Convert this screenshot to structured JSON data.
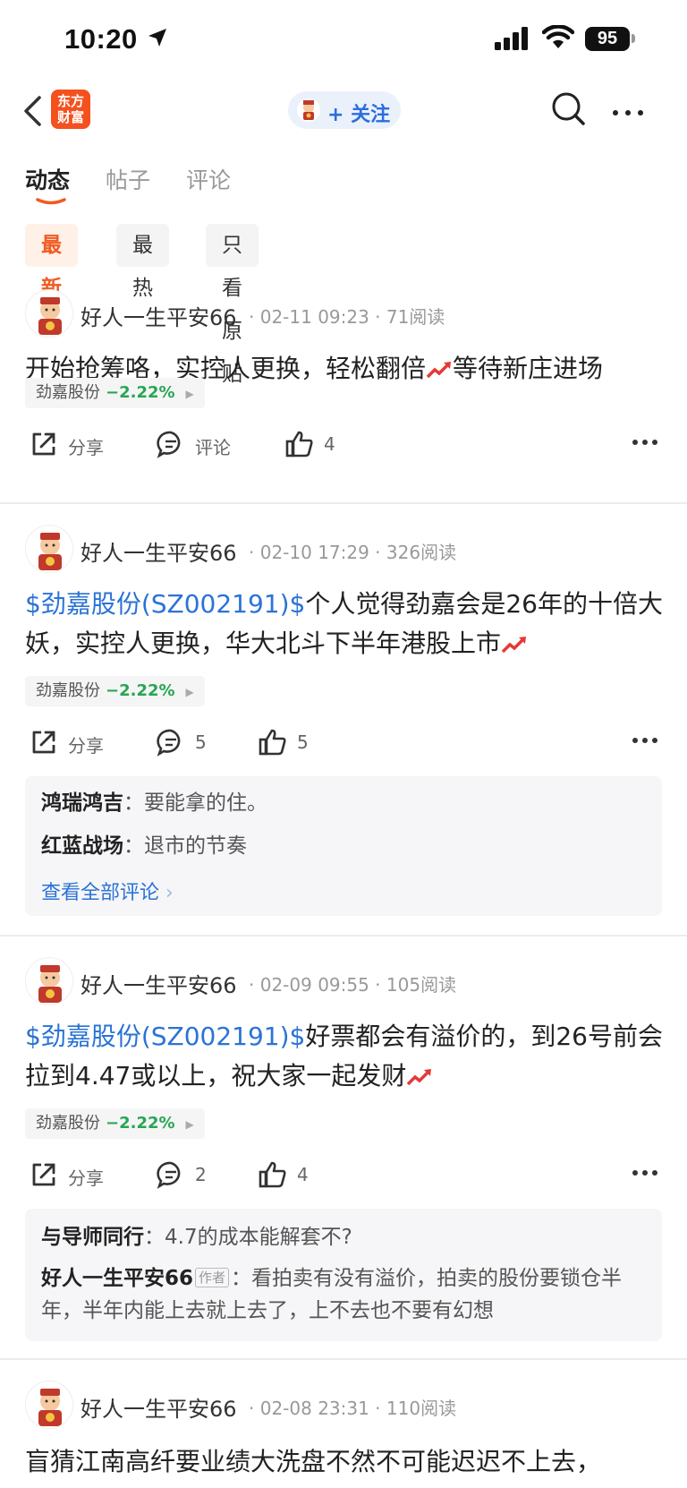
{
  "status": {
    "time": "10:20",
    "battery": "95"
  },
  "nav": {
    "logo_top": "东方",
    "logo_bottom": "财富",
    "follow_label": "+ 关注"
  },
  "tabs": [
    {
      "label": "动态"
    },
    {
      "label": "帖子"
    },
    {
      "label": "评论"
    }
  ],
  "filters": [
    {
      "label": "最新"
    },
    {
      "label": "最热"
    },
    {
      "label": "只看原贴"
    }
  ],
  "posts": [
    {
      "user": "好人一生平安66",
      "date": "02-11 09:23",
      "reads": "71阅读",
      "text_link": "",
      "text": "开始抢筹咯，实控人更换，轻松翻倍",
      "text_after": "等待新庄进场",
      "stock": "劲嘉股份",
      "pct": "−2.22%",
      "share": "分享",
      "comment": "评论",
      "likes": "4"
    },
    {
      "user": "好人一生平安66",
      "date": "02-10 17:29",
      "reads": "326阅读",
      "text_link": "$劲嘉股份(SZ002191)$",
      "text": "个人觉得劲嘉会是26年的十倍大妖，实控人更换，华大北斗下半年港股上市",
      "stock": "劲嘉股份",
      "pct": "−2.22%",
      "share": "分享",
      "comment": "5",
      "likes": "5",
      "comments": [
        {
          "author": "鸿瑞鸿吉",
          "text": "要能拿的住。"
        },
        {
          "author": "红蓝战场",
          "text": "退市的节奏"
        }
      ],
      "view_all": "查看全部评论"
    },
    {
      "user": "好人一生平安66",
      "date": "02-09 09:55",
      "reads": "105阅读",
      "text_link": "$劲嘉股份(SZ002191)$",
      "text": "好票都会有溢价的，到26号前会拉到4.47或以上，祝大家一起发财",
      "stock": "劲嘉股份",
      "pct": "−2.22%",
      "share": "分享",
      "comment": "2",
      "likes": "4",
      "comments": [
        {
          "author": "与导师同行",
          "text": "4.7的成本能解套不?"
        },
        {
          "author": "好人一生平安66",
          "tag": "作者",
          "text": "看拍卖有没有溢价，拍卖的股份要锁仓半年，半年内能上去就上去了，上不去也不要有幻想"
        }
      ]
    },
    {
      "user": "好人一生平安66",
      "date": "02-08 23:31",
      "reads": "110阅读",
      "text": "盲猜江南高纤要业绩大洗盘不然不可能迟迟不上去，"
    }
  ]
}
